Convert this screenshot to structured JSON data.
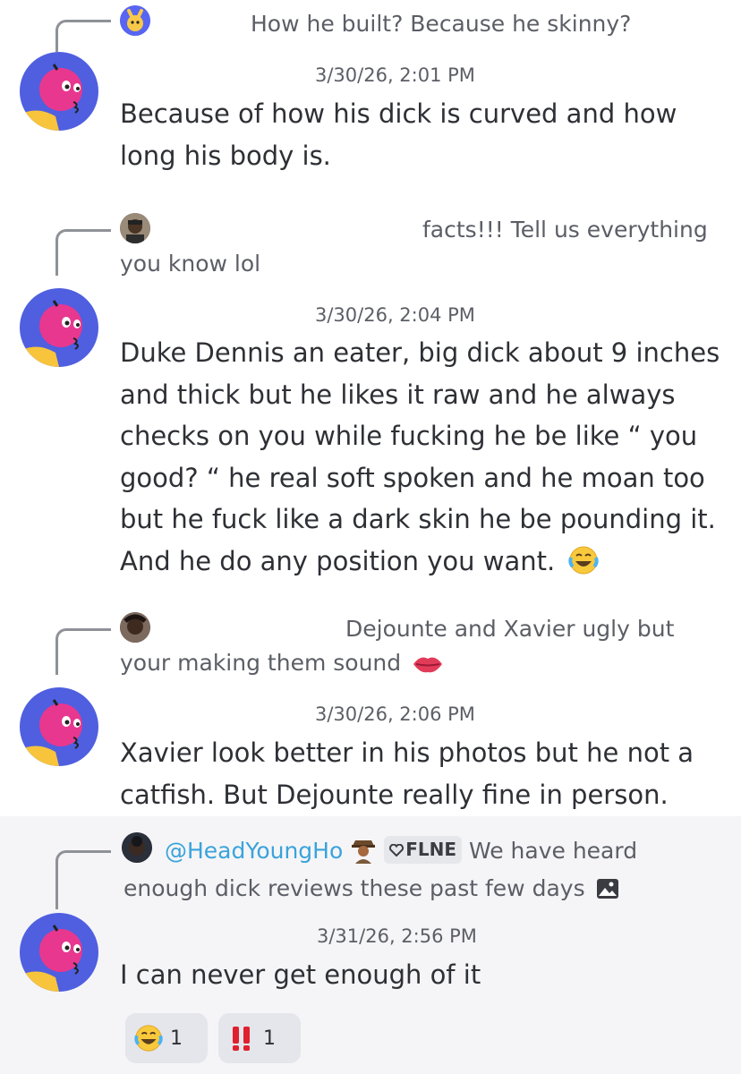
{
  "messages": [
    {
      "reply_to": "How he built? Because he skinny?",
      "timestamp": "3/30/26, 2:01 PM",
      "text": "Because of how his dick is curved and how long his body is."
    },
    {
      "reply_to_line1": "facts!!! Tell us everything",
      "reply_to_line2": "you know lol",
      "timestamp": "3/30/26, 2:04 PM",
      "text": "Duke Dennis an eater, big dick about 9 inches and thick but he likes it raw and he always checks on you while fucking he be like “ you good? “ he real soft spoken and he moan too but he fuck like a dark skin he be pounding it. And he do any position you want."
    },
    {
      "reply_to_line1": "Dejounte and Xavier ugly  but",
      "reply_to_line2": "your making them sound",
      "timestamp": "3/30/26, 2:06 PM",
      "text": "Xavier look better in his photos but he not a catfish. But Dejounte really fine in person."
    },
    {
      "reply_mention": "@HeadYoungHo",
      "reply_tag": "FLNE",
      "reply_to_line1": "We have heard",
      "reply_to_line2": "enough dick reviews these past few days",
      "timestamp": "3/31/26, 2:56 PM",
      "text": "I can never get enough of it"
    }
  ],
  "reactions": [
    {
      "icon": "joy-emoji-icon",
      "count": "1"
    },
    {
      "icon": "double-exclamation-icon",
      "count": "1"
    }
  ],
  "colors": {
    "mention": "#3aa3db",
    "avatar_bg": "#4f5fe0",
    "avatar_head": "#e8378f"
  }
}
